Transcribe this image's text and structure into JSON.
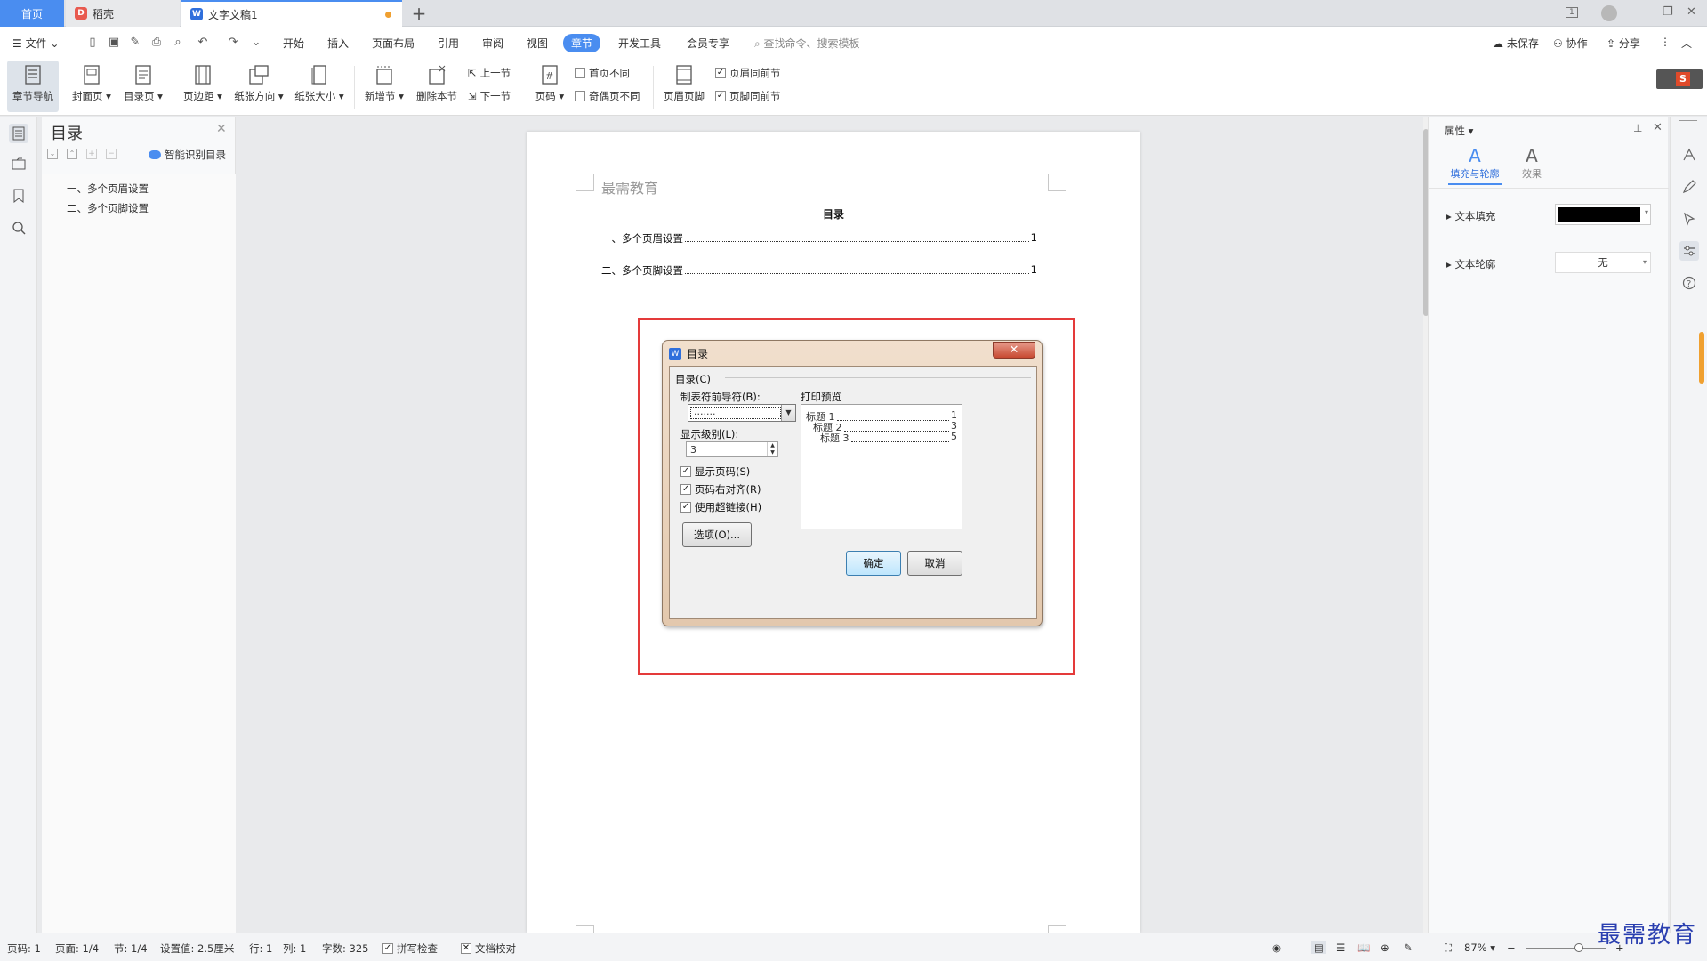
{
  "tabs": {
    "home": "首页",
    "daoke": "稻壳",
    "doc": "文字文稿1",
    "home_badge": "1"
  },
  "menu": {
    "file": "文件",
    "items": [
      "开始",
      "插入",
      "页面布局",
      "引用",
      "审阅",
      "视图",
      "章节",
      "开发工具",
      "会员专享"
    ],
    "active": "章节",
    "search_placeholder": "查找命令、搜索模板",
    "unsaved": "未保存",
    "collab": "协作",
    "share": "分享"
  },
  "ribbon": {
    "chapter_nav": "章节导航",
    "cover": "封面页",
    "toc_page": "目录页",
    "margin": "页边距",
    "orientation": "纸张方向",
    "size": "纸张大小",
    "new_section": "新增节",
    "delete_section": "删除本节",
    "prev_section": "上一节",
    "next_section": "下一节",
    "page_num": "页码",
    "first_diff": "首页不同",
    "odd_even_diff": "奇偶页不同",
    "header_footer": "页眉页脚",
    "header_same": "页眉同前节",
    "footer_same": "页脚同前节"
  },
  "toc_panel": {
    "title": "目录",
    "smart": "智能识别目录",
    "items": [
      "一、多个页眉设置",
      "二、多个页脚设置"
    ]
  },
  "document": {
    "header_text": "最需教育",
    "toc_title": "目录",
    "toc_entries": [
      {
        "text": "一、多个页眉设置",
        "page": "1"
      },
      {
        "text": "二、多个页脚设置",
        "page": "1"
      }
    ]
  },
  "dialog": {
    "title": "目录",
    "group": "目录(C)",
    "leader_label": "制表符前导符(B):",
    "leader_value": ".......",
    "level_label": "显示级别(L):",
    "level_value": "3",
    "show_page": "显示页码(S)",
    "align_right": "页码右对齐(R)",
    "hyperlink": "使用超链接(H)",
    "options": "选项(O)...",
    "preview_label": "打印预览",
    "preview": [
      {
        "title": "标题 1",
        "page": "1"
      },
      {
        "title": "标题 2",
        "page": "3"
      },
      {
        "title": "标题 3",
        "page": "5"
      }
    ],
    "ok": "确定",
    "cancel": "取消"
  },
  "props": {
    "title": "属性",
    "tab_fill": "填充与轮廓",
    "tab_effect": "效果",
    "text_fill": "文本填充",
    "text_outline": "文本轮廓",
    "outline_value": "无"
  },
  "status": {
    "page_code": "页码: 1",
    "page": "页面: 1/4",
    "section": "节: 1/4",
    "setting": "设置值: 2.5厘米",
    "row": "行: 1",
    "col": "列: 1",
    "words": "字数: 325",
    "spell": "拼写检查",
    "proof": "文档校对",
    "zoom": "87%"
  },
  "watermark": "最需教育"
}
